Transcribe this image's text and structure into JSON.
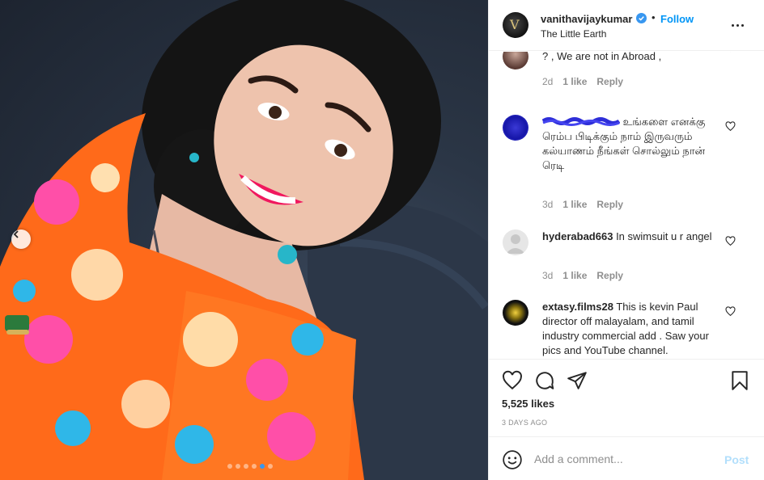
{
  "post": {
    "username": "vanithavijaykumar",
    "follow_separator": "•",
    "follow_label": "Follow",
    "location": "The Little Earth",
    "likes": "5,525 likes",
    "date": "3 DAYS AGO",
    "carousel": {
      "slides": 6,
      "active_slide": 5
    }
  },
  "comments": [
    {
      "username": "",
      "text": "? , We are not in Abroad ,",
      "age": "2d",
      "likes": "1 like",
      "reply": "Reply"
    },
    {
      "username": "",
      "text": "உங்களை எனக்கு ரெம்ப பிடிக்கும் நாம் இருவரும் கல்யாணம் நீங்கள் சொல்லும் நான் ரெடி",
      "age": "3d",
      "likes": "1 like",
      "reply": "Reply"
    },
    {
      "username": "hyderabad663",
      "text": "In swimsuit u r angel",
      "age": "3d",
      "likes": "1 like",
      "reply": "Reply"
    },
    {
      "username": "extasy.films28",
      "text": "This is kevin Paul director off malayalam, and tamil industry commercial add . Saw your pics and YouTube channel.",
      "age": "",
      "likes": "",
      "reply": ""
    }
  ],
  "add_comment": {
    "placeholder": "Add a comment...",
    "post_label": "Post"
  },
  "icons": {
    "prev": "chevron-left-icon",
    "verified": "verified-badge-icon",
    "more": "more-options-icon",
    "like": "heart-icon",
    "comment": "comment-icon",
    "share": "send-icon",
    "save": "bookmark-icon",
    "emoji": "emoji-icon"
  },
  "colors": {
    "accent": "#0095f6",
    "post_disabled": "#b2dffc",
    "meta": "#8e8e8e",
    "verified": "#3897f0"
  }
}
